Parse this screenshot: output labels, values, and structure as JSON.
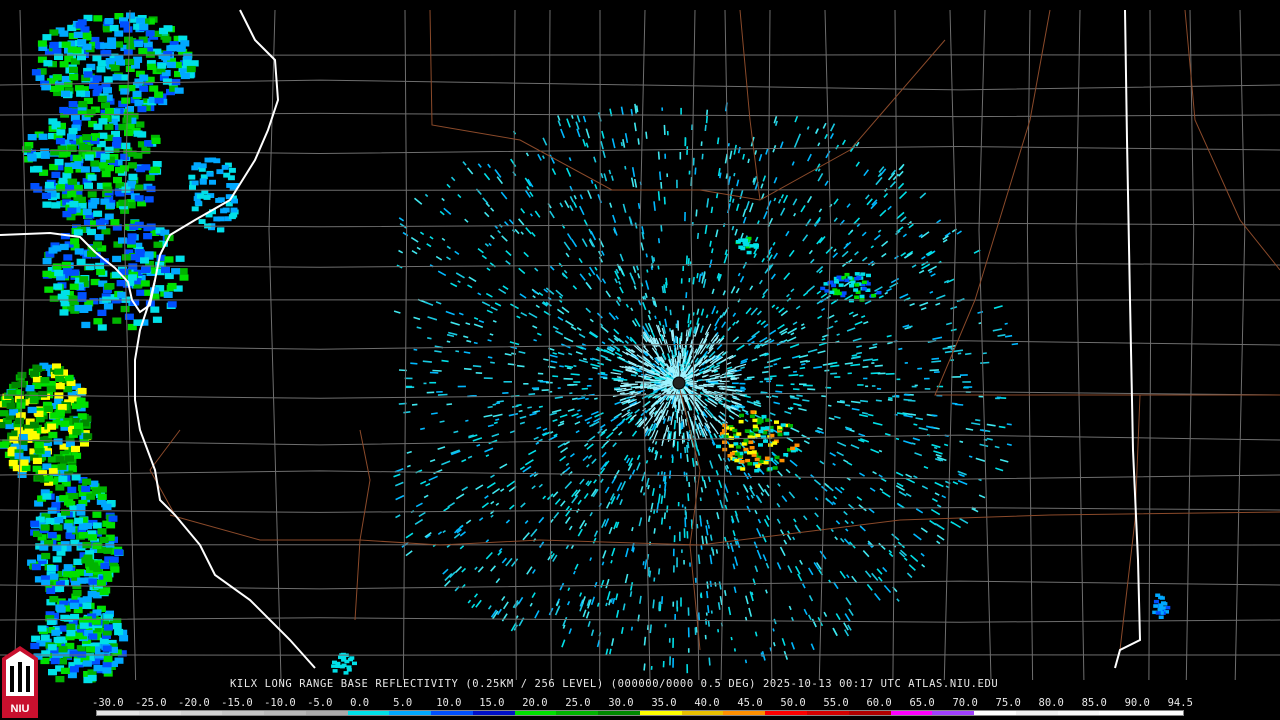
{
  "caption": "KILX LONG RANGE BASE REFLECTIVITY (0.25KM / 256 LEVEL) (000000/0000 0.5 DEG) 2025-10-13 00:17 UTC  ATLAS.NIU.EDU",
  "logo_text": "NIU",
  "colors": {
    "background": "#000000",
    "county_lines": "#6e6e6e",
    "state_lines": "#ffffff",
    "roads": "#8b4a2a",
    "radar_site": "#222222"
  },
  "scale": {
    "labels": [
      "-30.0",
      "-25.0",
      "-20.0",
      "-15.0",
      "-10.0",
      "-5.0",
      "0.0",
      "5.0",
      "10.0",
      "15.0",
      "20.0",
      "25.0",
      "30.0",
      "35.0",
      "40.0",
      "45.0",
      "50.0",
      "55.0",
      "60.0",
      "65.0",
      "70.0",
      "75.0",
      "80.0",
      "85.0",
      "90.0",
      "94.5"
    ],
    "colors": [
      "#e6e6e6",
      "#dcdcdc",
      "#d0d0d0",
      "#c4c4c4",
      "#b8b8b8",
      "#aaaaaa",
      "#00e0e8",
      "#00a8ff",
      "#0050ff",
      "#0010c8",
      "#00e000",
      "#00b400",
      "#008800",
      "#ffff00",
      "#e8c000",
      "#ff9000",
      "#ff0000",
      "#d40000",
      "#b00000",
      "#ff00ff",
      "#a040ff",
      "#ffffff",
      "#f0f0f0",
      "#f8f8f8",
      "#ffffff",
      "#ffffff"
    ]
  }
}
